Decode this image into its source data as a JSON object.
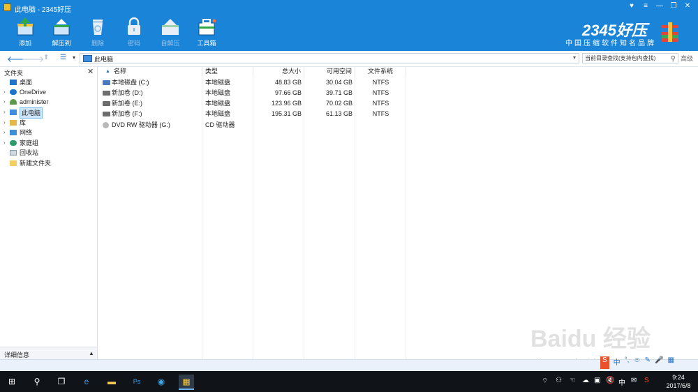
{
  "window": {
    "title": "此电脑 - 2345好压"
  },
  "titlebar": {
    "buttons": [
      "♥",
      "≡",
      "—",
      "❐",
      "✕"
    ]
  },
  "toolbar": {
    "items": [
      {
        "label": "添加",
        "icon": "add-archive-icon",
        "enabled": true
      },
      {
        "label": "解压到",
        "icon": "extract-icon",
        "enabled": true
      },
      {
        "label": "删除",
        "icon": "delete-icon",
        "enabled": false
      },
      {
        "label": "密码",
        "icon": "lock-icon",
        "enabled": false
      },
      {
        "label": "自解压",
        "icon": "self-extract-icon",
        "enabled": false
      },
      {
        "label": "工具箱",
        "icon": "toolbox-icon",
        "enabled": true
      }
    ]
  },
  "brand": {
    "title": "2345好压",
    "subtitle": "中国压缩软件知名品牌"
  },
  "address": {
    "path": "此电脑",
    "search_placeholder": "当前目录查找(支持包内查找)",
    "advanced": "高级"
  },
  "left_pane": {
    "header": "文件夹",
    "tree": [
      {
        "label": "桌面",
        "icon": "desktop-icon",
        "expandable": false,
        "selected": false
      },
      {
        "label": "OneDrive",
        "icon": "cloud-icon",
        "expandable": true,
        "selected": false
      },
      {
        "label": "administer",
        "icon": "user-icon",
        "expandable": true,
        "selected": false
      },
      {
        "label": "此电脑",
        "icon": "computer-icon",
        "expandable": true,
        "selected": true
      },
      {
        "label": "库",
        "icon": "library-icon",
        "expandable": true,
        "selected": false
      },
      {
        "label": "网络",
        "icon": "network-icon",
        "expandable": true,
        "selected": false
      },
      {
        "label": "家庭组",
        "icon": "homegroup-icon",
        "expandable": true,
        "selected": false
      },
      {
        "label": "回收站",
        "icon": "recycle-bin-icon",
        "expandable": false,
        "selected": false
      },
      {
        "label": "新建文件夹",
        "icon": "folder-icon",
        "expandable": false,
        "selected": false
      }
    ],
    "details_label": "详细信息"
  },
  "file_list": {
    "columns": [
      "名称",
      "类型",
      "总大小",
      "可用空间",
      "文件系统"
    ],
    "rows": [
      {
        "name": "本地磁盘 (C:)",
        "type": "本地磁盘",
        "total": "48.83 GB",
        "free": "30.04 GB",
        "fs": "NTFS",
        "icon": "system-drive-icon"
      },
      {
        "name": "新加卷 (D:)",
        "type": "本地磁盘",
        "total": "97.66 GB",
        "free": "39.71 GB",
        "fs": "NTFS",
        "icon": "drive-icon"
      },
      {
        "name": "新加卷 (E:)",
        "type": "本地磁盘",
        "total": "123.96 GB",
        "free": "70.02 GB",
        "fs": "NTFS",
        "icon": "drive-icon"
      },
      {
        "name": "新加卷 (F:)",
        "type": "本地磁盘",
        "total": "195.31 GB",
        "free": "61.13 GB",
        "fs": "NTFS",
        "icon": "drive-icon"
      },
      {
        "name": "DVD RW 驱动器 (G:)",
        "type": "CD 驱动器",
        "total": "",
        "free": "",
        "fs": "",
        "icon": "dvd-drive-icon"
      }
    ]
  },
  "taskbar": {
    "time": "9:24",
    "date": "2017/6/8",
    "ime": "中"
  },
  "watermark": {
    "text": "Baidu 经验",
    "url": "jingyan.baidu.com"
  }
}
